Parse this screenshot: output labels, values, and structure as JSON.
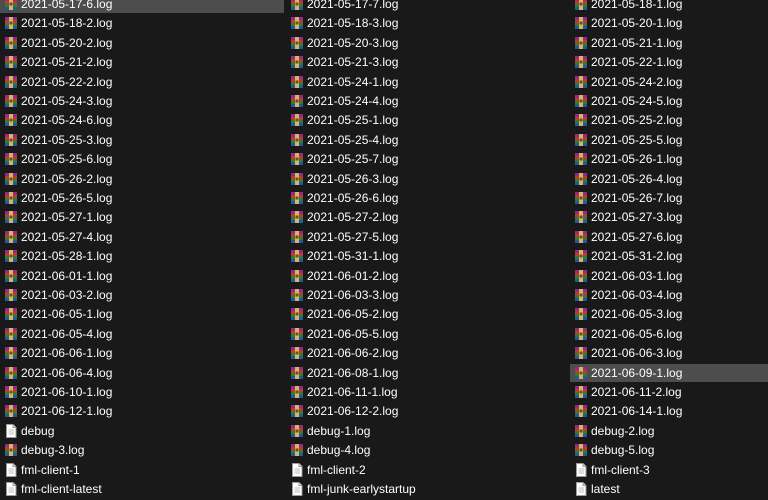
{
  "window": {
    "background": "#191919",
    "selection_color": "#4d4d4d",
    "text_color": "#ffffff"
  },
  "files": [
    [
      "2021-05-17-6.log",
      "2021-05-17-7.log",
      "2021-05-18-1.log"
    ],
    [
      "2021-05-18-2.log",
      "2021-05-18-3.log",
      "2021-05-20-1.log"
    ],
    [
      "2021-05-20-2.log",
      "2021-05-20-3.log",
      "2021-05-21-1.log"
    ],
    [
      "2021-05-21-2.log",
      "2021-05-21-3.log",
      "2021-05-22-1.log"
    ],
    [
      "2021-05-22-2.log",
      "2021-05-24-1.log",
      "2021-05-24-2.log"
    ],
    [
      "2021-05-24-3.log",
      "2021-05-24-4.log",
      "2021-05-24-5.log"
    ],
    [
      "2021-05-24-6.log",
      "2021-05-25-1.log",
      "2021-05-25-2.log"
    ],
    [
      "2021-05-25-3.log",
      "2021-05-25-4.log",
      "2021-05-25-5.log"
    ],
    [
      "2021-05-25-6.log",
      "2021-05-25-7.log",
      "2021-05-26-1.log"
    ],
    [
      "2021-05-26-2.log",
      "2021-05-26-3.log",
      "2021-05-26-4.log"
    ],
    [
      "2021-05-26-5.log",
      "2021-05-26-6.log",
      "2021-05-26-7.log"
    ],
    [
      "2021-05-27-1.log",
      "2021-05-27-2.log",
      "2021-05-27-3.log"
    ],
    [
      "2021-05-27-4.log",
      "2021-05-27-5.log",
      "2021-05-27-6.log"
    ],
    [
      "2021-05-28-1.log",
      "2021-05-31-1.log",
      "2021-05-31-2.log"
    ],
    [
      "2021-06-01-1.log",
      "2021-06-01-2.log",
      "2021-06-03-1.log"
    ],
    [
      "2021-06-03-2.log",
      "2021-06-03-3.log",
      "2021-06-03-4.log"
    ],
    [
      "2021-06-05-1.log",
      "2021-06-05-2.log",
      "2021-06-05-3.log"
    ],
    [
      "2021-06-05-4.log",
      "2021-06-05-5.log",
      "2021-06-05-6.log"
    ],
    [
      "2021-06-06-1.log",
      "2021-06-06-2.log",
      "2021-06-06-3.log"
    ],
    [
      "2021-06-06-4.log",
      "2021-06-08-1.log",
      "2021-06-09-1.log"
    ],
    [
      "2021-06-10-1.log",
      "2021-06-11-1.log",
      "2021-06-11-2.log"
    ],
    [
      "2021-06-12-1.log",
      "2021-06-12-2.log",
      "2021-06-14-1.log"
    ],
    [
      "debug",
      "debug-1.log",
      "debug-2.log"
    ],
    [
      "debug-3.log",
      "debug-4.log",
      "debug-5.log"
    ],
    [
      "fml-client-1",
      "fml-client-2",
      "fml-client-3"
    ],
    [
      "fml-client-latest",
      "fml-junk-earlystartup",
      "latest"
    ]
  ],
  "icons": [
    [
      "archive-icon",
      "archive-icon",
      "archive-icon"
    ],
    [
      "archive-icon",
      "archive-icon",
      "archive-icon"
    ],
    [
      "archive-icon",
      "archive-icon",
      "archive-icon"
    ],
    [
      "archive-icon",
      "archive-icon",
      "archive-icon"
    ],
    [
      "archive-icon",
      "archive-icon",
      "archive-icon"
    ],
    [
      "archive-icon",
      "archive-icon",
      "archive-icon"
    ],
    [
      "archive-icon",
      "archive-icon",
      "archive-icon"
    ],
    [
      "archive-icon",
      "archive-icon",
      "archive-icon"
    ],
    [
      "archive-icon",
      "archive-icon",
      "archive-icon"
    ],
    [
      "archive-icon",
      "archive-icon",
      "archive-icon"
    ],
    [
      "archive-icon",
      "archive-icon",
      "archive-icon"
    ],
    [
      "archive-icon",
      "archive-icon",
      "archive-icon"
    ],
    [
      "archive-icon",
      "archive-icon",
      "archive-icon"
    ],
    [
      "archive-icon",
      "archive-icon",
      "archive-icon"
    ],
    [
      "archive-icon",
      "archive-icon",
      "archive-icon"
    ],
    [
      "archive-icon",
      "archive-icon",
      "archive-icon"
    ],
    [
      "archive-icon",
      "archive-icon",
      "archive-icon"
    ],
    [
      "archive-icon",
      "archive-icon",
      "archive-icon"
    ],
    [
      "archive-icon",
      "archive-icon",
      "archive-icon"
    ],
    [
      "archive-icon",
      "archive-icon",
      "archive-icon"
    ],
    [
      "archive-icon",
      "archive-icon",
      "archive-icon"
    ],
    [
      "archive-icon",
      "archive-icon",
      "archive-icon"
    ],
    [
      "text-file-icon",
      "archive-icon",
      "archive-icon"
    ],
    [
      "archive-icon",
      "archive-icon",
      "archive-icon"
    ],
    [
      "text-file-icon",
      "text-file-icon",
      "text-file-icon"
    ],
    [
      "text-file-icon",
      "text-file-icon",
      "text-file-icon"
    ]
  ],
  "selected": [
    [
      0,
      0
    ],
    [
      19,
      2
    ]
  ]
}
